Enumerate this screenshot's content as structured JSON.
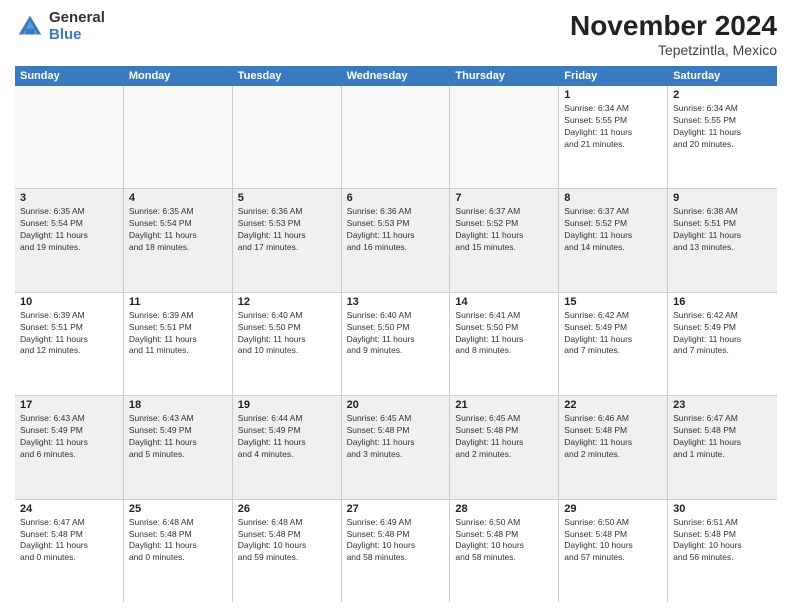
{
  "logo": {
    "general": "General",
    "blue": "Blue"
  },
  "title": "November 2024",
  "subtitle": "Tepetzintla, Mexico",
  "header_days": [
    "Sunday",
    "Monday",
    "Tuesday",
    "Wednesday",
    "Thursday",
    "Friday",
    "Saturday"
  ],
  "weeks": [
    [
      {
        "day": "",
        "empty": true
      },
      {
        "day": "",
        "empty": true
      },
      {
        "day": "",
        "empty": true
      },
      {
        "day": "",
        "empty": true
      },
      {
        "day": "",
        "empty": true
      },
      {
        "day": "1",
        "info": "Sunrise: 6:34 AM\nSunset: 5:55 PM\nDaylight: 11 hours\nand 21 minutes."
      },
      {
        "day": "2",
        "info": "Sunrise: 6:34 AM\nSunset: 5:55 PM\nDaylight: 11 hours\nand 20 minutes."
      }
    ],
    [
      {
        "day": "3",
        "info": "Sunrise: 6:35 AM\nSunset: 5:54 PM\nDaylight: 11 hours\nand 19 minutes."
      },
      {
        "day": "4",
        "info": "Sunrise: 6:35 AM\nSunset: 5:54 PM\nDaylight: 11 hours\nand 18 minutes."
      },
      {
        "day": "5",
        "info": "Sunrise: 6:36 AM\nSunset: 5:53 PM\nDaylight: 11 hours\nand 17 minutes."
      },
      {
        "day": "6",
        "info": "Sunrise: 6:36 AM\nSunset: 5:53 PM\nDaylight: 11 hours\nand 16 minutes."
      },
      {
        "day": "7",
        "info": "Sunrise: 6:37 AM\nSunset: 5:52 PM\nDaylight: 11 hours\nand 15 minutes."
      },
      {
        "day": "8",
        "info": "Sunrise: 6:37 AM\nSunset: 5:52 PM\nDaylight: 11 hours\nand 14 minutes."
      },
      {
        "day": "9",
        "info": "Sunrise: 6:38 AM\nSunset: 5:51 PM\nDaylight: 11 hours\nand 13 minutes."
      }
    ],
    [
      {
        "day": "10",
        "info": "Sunrise: 6:39 AM\nSunset: 5:51 PM\nDaylight: 11 hours\nand 12 minutes."
      },
      {
        "day": "11",
        "info": "Sunrise: 6:39 AM\nSunset: 5:51 PM\nDaylight: 11 hours\nand 11 minutes."
      },
      {
        "day": "12",
        "info": "Sunrise: 6:40 AM\nSunset: 5:50 PM\nDaylight: 11 hours\nand 10 minutes."
      },
      {
        "day": "13",
        "info": "Sunrise: 6:40 AM\nSunset: 5:50 PM\nDaylight: 11 hours\nand 9 minutes."
      },
      {
        "day": "14",
        "info": "Sunrise: 6:41 AM\nSunset: 5:50 PM\nDaylight: 11 hours\nand 8 minutes."
      },
      {
        "day": "15",
        "info": "Sunrise: 6:42 AM\nSunset: 5:49 PM\nDaylight: 11 hours\nand 7 minutes."
      },
      {
        "day": "16",
        "info": "Sunrise: 6:42 AM\nSunset: 5:49 PM\nDaylight: 11 hours\nand 7 minutes."
      }
    ],
    [
      {
        "day": "17",
        "info": "Sunrise: 6:43 AM\nSunset: 5:49 PM\nDaylight: 11 hours\nand 6 minutes."
      },
      {
        "day": "18",
        "info": "Sunrise: 6:43 AM\nSunset: 5:49 PM\nDaylight: 11 hours\nand 5 minutes."
      },
      {
        "day": "19",
        "info": "Sunrise: 6:44 AM\nSunset: 5:49 PM\nDaylight: 11 hours\nand 4 minutes."
      },
      {
        "day": "20",
        "info": "Sunrise: 6:45 AM\nSunset: 5:48 PM\nDaylight: 11 hours\nand 3 minutes."
      },
      {
        "day": "21",
        "info": "Sunrise: 6:45 AM\nSunset: 5:48 PM\nDaylight: 11 hours\nand 2 minutes."
      },
      {
        "day": "22",
        "info": "Sunrise: 6:46 AM\nSunset: 5:48 PM\nDaylight: 11 hours\nand 2 minutes."
      },
      {
        "day": "23",
        "info": "Sunrise: 6:47 AM\nSunset: 5:48 PM\nDaylight: 11 hours\nand 1 minute."
      }
    ],
    [
      {
        "day": "24",
        "info": "Sunrise: 6:47 AM\nSunset: 5:48 PM\nDaylight: 11 hours\nand 0 minutes."
      },
      {
        "day": "25",
        "info": "Sunrise: 6:48 AM\nSunset: 5:48 PM\nDaylight: 11 hours\nand 0 minutes."
      },
      {
        "day": "26",
        "info": "Sunrise: 6:48 AM\nSunset: 5:48 PM\nDaylight: 10 hours\nand 59 minutes."
      },
      {
        "day": "27",
        "info": "Sunrise: 6:49 AM\nSunset: 5:48 PM\nDaylight: 10 hours\nand 58 minutes."
      },
      {
        "day": "28",
        "info": "Sunrise: 6:50 AM\nSunset: 5:48 PM\nDaylight: 10 hours\nand 58 minutes."
      },
      {
        "day": "29",
        "info": "Sunrise: 6:50 AM\nSunset: 5:48 PM\nDaylight: 10 hours\nand 57 minutes."
      },
      {
        "day": "30",
        "info": "Sunrise: 6:51 AM\nSunset: 5:48 PM\nDaylight: 10 hours\nand 56 minutes."
      }
    ]
  ]
}
